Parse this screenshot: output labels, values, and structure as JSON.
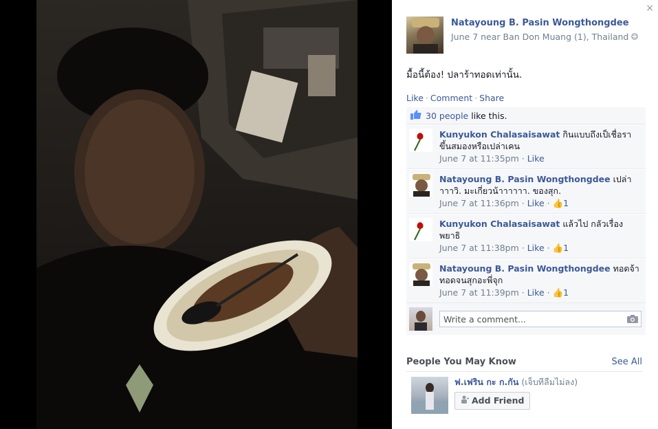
{
  "panel": {
    "close_label": "×",
    "author": "Natayoung B. Pasin Wongthongdee",
    "meta_date": "June 7 near Ban Don Muang (1), Thailand",
    "caption": "มื้อนี้ต้อง! ปลาร้าทอดเท่านั้น.",
    "actions": {
      "like": "Like",
      "comment": "Comment",
      "share": "Share",
      "separator": "·"
    },
    "likes": {
      "count_link": "30 people",
      "rest": "like this."
    },
    "comments": [
      {
        "author": "Kunyukon Chalasaisawat",
        "text": "กินแบบถึงเป็เชื่อราขึ้นสมองหรือเปล่าเคน",
        "time": "June 7 at 11:35pm",
        "like_label": "Like",
        "like_count": ""
      },
      {
        "author": "Natayoung B. Pasin Wongthongdee",
        "text": "เปล่าาาาวิ. มะเกี่ยวน้าาาาาา. ของสุก.",
        "time": "June 7 at 11:36pm",
        "like_label": "Like",
        "like_count": "1"
      },
      {
        "author": "Kunyukon Chalasaisawat",
        "text": "แล้วไป กลัวเรื่องพยาธิ",
        "time": "June 7 at 11:38pm",
        "like_label": "Like",
        "like_count": "1"
      },
      {
        "author": "Natayoung B. Pasin Wongthongdee",
        "text": "ทอดจ้า ทอดจนสุกอะพี่จุก",
        "time": "June 7 at 11:39pm",
        "like_label": "Like",
        "like_count": "1"
      }
    ],
    "write_comment_placeholder": "Write a comment...",
    "pymk": {
      "title": "People You May Know",
      "see_all": "See All",
      "person_name": "ฟ.เฟริน กะ ก.กัน",
      "person_sub": "(เจ็บทีลืมไม่ลง)",
      "add_friend": "Add Friend"
    }
  },
  "colors": {
    "link": "#3b5998",
    "meta": "#6d7f8f",
    "ufi_bg": "#f6f7f9"
  }
}
